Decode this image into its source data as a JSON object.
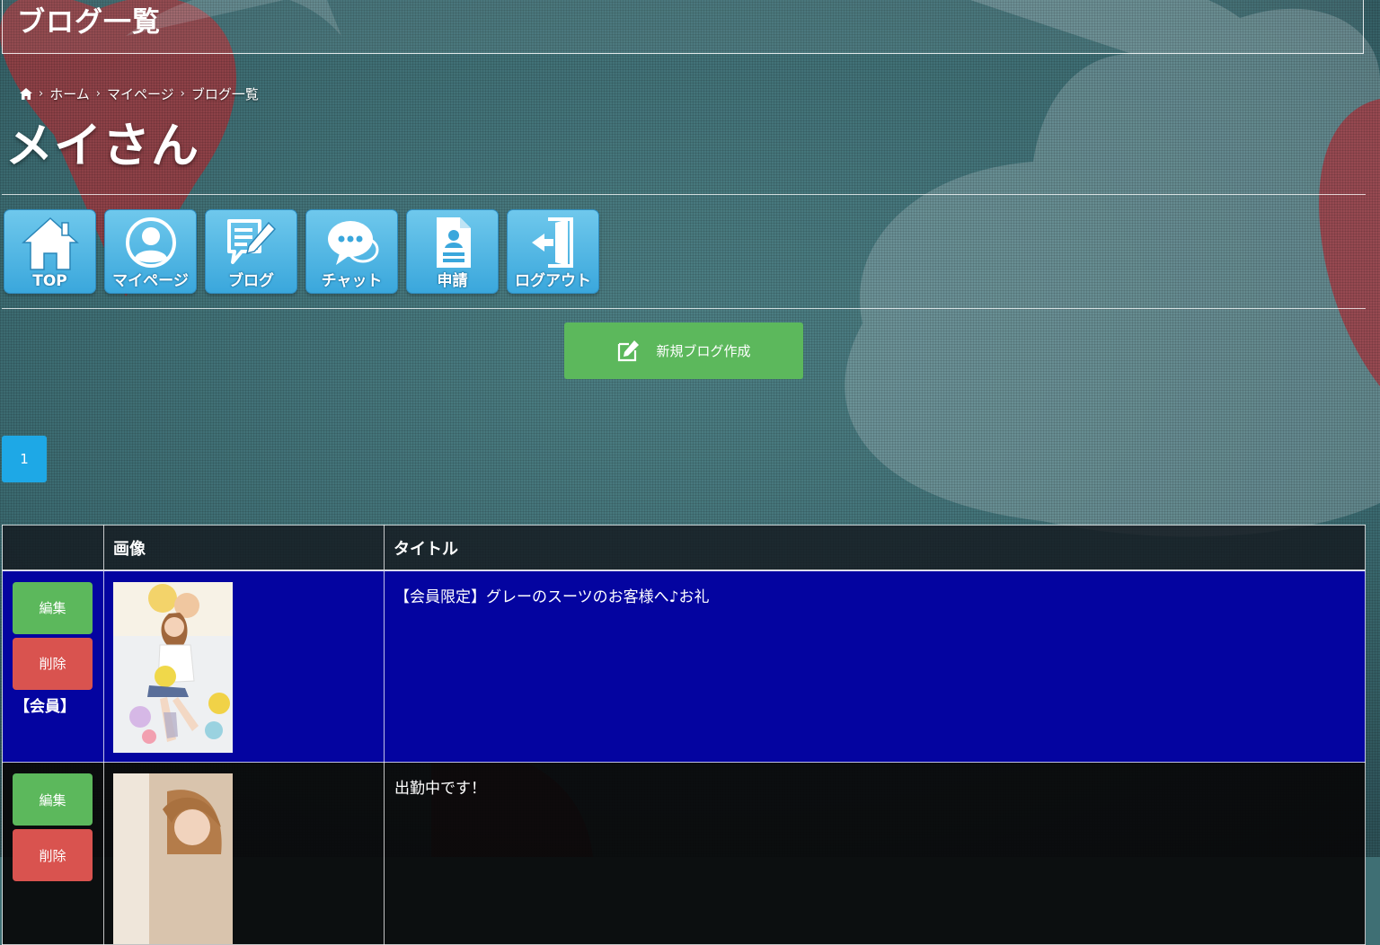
{
  "page_title": "ブログ一覧",
  "breadcrumb": {
    "items": [
      "ホーム",
      "マイページ",
      "ブログ一覧"
    ],
    "separator": "›"
  },
  "user": {
    "name": "メイさん"
  },
  "nav": [
    {
      "label": "TOP",
      "icon": "home-icon"
    },
    {
      "label": "マイページ",
      "icon": "user-icon"
    },
    {
      "label": "ブログ",
      "icon": "blog-edit-icon"
    },
    {
      "label": "チャット",
      "icon": "chat-icon"
    },
    {
      "label": "申請",
      "icon": "document-icon"
    },
    {
      "label": "ログアウト",
      "icon": "logout-icon"
    }
  ],
  "new_blog_button": "新規ブログ作成",
  "pagination": {
    "current": "1"
  },
  "table": {
    "headers": [
      "",
      "画像",
      "タイトル"
    ],
    "rows": [
      {
        "edit": "編集",
        "delete": "削除",
        "tag": "【会員】",
        "title": "【会員限定】グレーのスーツのお客様へ♪お礼",
        "row_color": "#0404a0"
      },
      {
        "edit": "編集",
        "delete": "削除",
        "tag": "",
        "title": "出勤中です！",
        "row_color": "#080608"
      }
    ]
  },
  "colors": {
    "accent_blue": "#1ea8e6",
    "button_green": "#5cb85c",
    "button_red": "#d9534f",
    "nav_blue": "#3aa7dc"
  }
}
